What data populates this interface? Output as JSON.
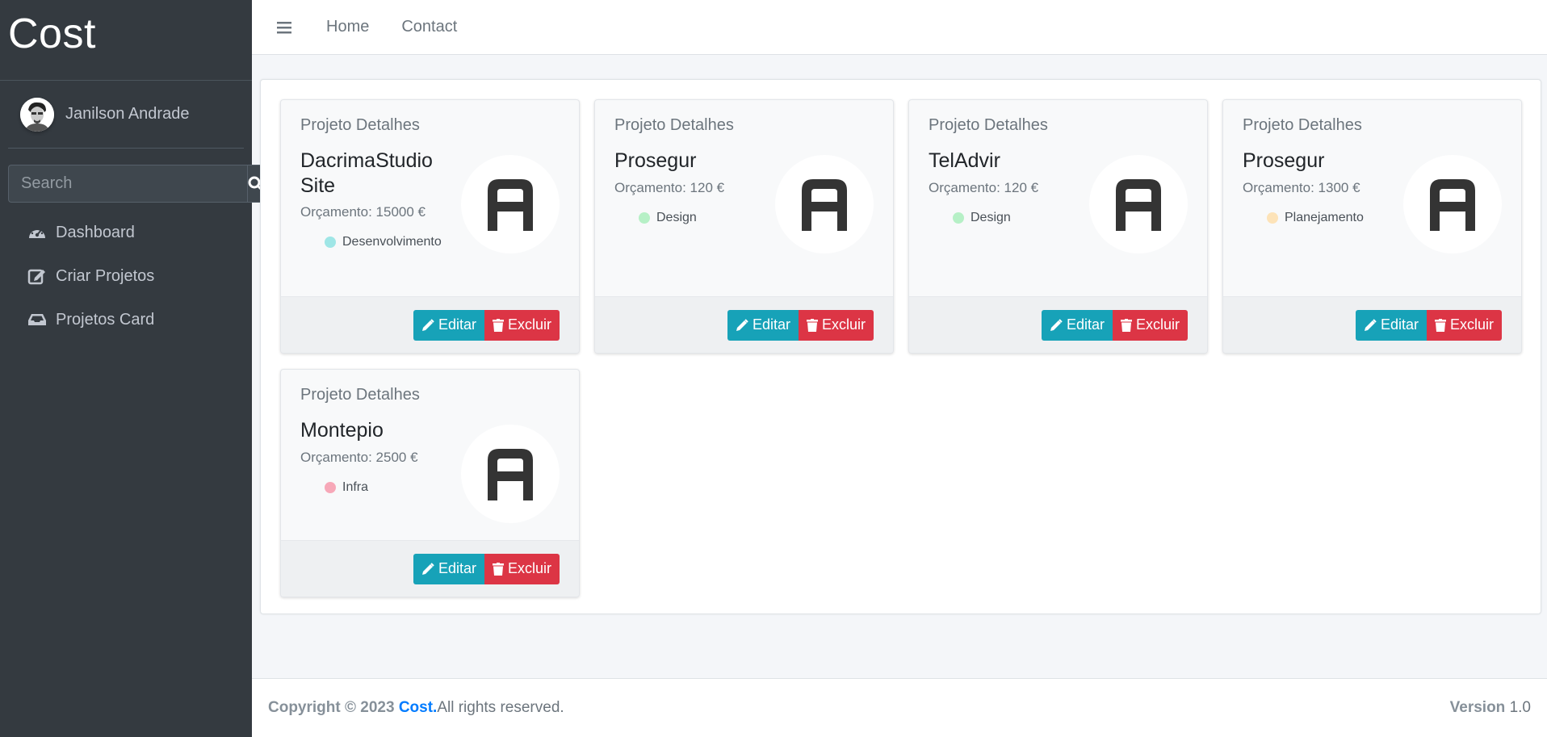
{
  "brand": "Cost",
  "user": {
    "name": "Janilson Andrade"
  },
  "search": {
    "placeholder": "Search"
  },
  "nav": [
    {
      "label": "Dashboard",
      "icon": "tachometer-icon"
    },
    {
      "label": "Criar Projetos",
      "icon": "edit-icon"
    },
    {
      "label": "Projetos Card",
      "icon": "inbox-icon"
    }
  ],
  "topnav": {
    "home": "Home",
    "contact": "Contact"
  },
  "projects": [
    {
      "header": "Projeto Detalhes",
      "name": "DacrimaStudio Site",
      "budget": "Orçamento: 15000 €",
      "category": "Desenvolvimento",
      "category_color": "#9fe6e6"
    },
    {
      "header": "Projeto Detalhes",
      "name": "Prosegur",
      "budget": "Orçamento: 120 €",
      "category": "Design",
      "category_color": "#b6f0c6"
    },
    {
      "header": "Projeto Detalhes",
      "name": "TelAdvir",
      "budget": "Orçamento: 120 €",
      "category": "Design",
      "category_color": "#b6f0c6"
    },
    {
      "header": "Projeto Detalhes",
      "name": "Prosegur",
      "budget": "Orçamento: 1300 €",
      "category": "Planejamento",
      "category_color": "#fde3b8"
    },
    {
      "header": "Projeto Detalhes",
      "name": "Montepio",
      "budget": "Orçamento: 2500 €",
      "category": "Infra",
      "category_color": "#f7a8b8"
    }
  ],
  "buttons": {
    "edit": "Editar",
    "delete": "Excluir"
  },
  "footer": {
    "copyright": "Copyright © 2023",
    "brand": "Cost.",
    "rights": "All rights reserved.",
    "version_label": "Version",
    "version": "1.0"
  },
  "colors": {
    "sidebar": "#343a40",
    "edit": "#17a2b8",
    "delete": "#dc3545",
    "link": "#007bff"
  }
}
